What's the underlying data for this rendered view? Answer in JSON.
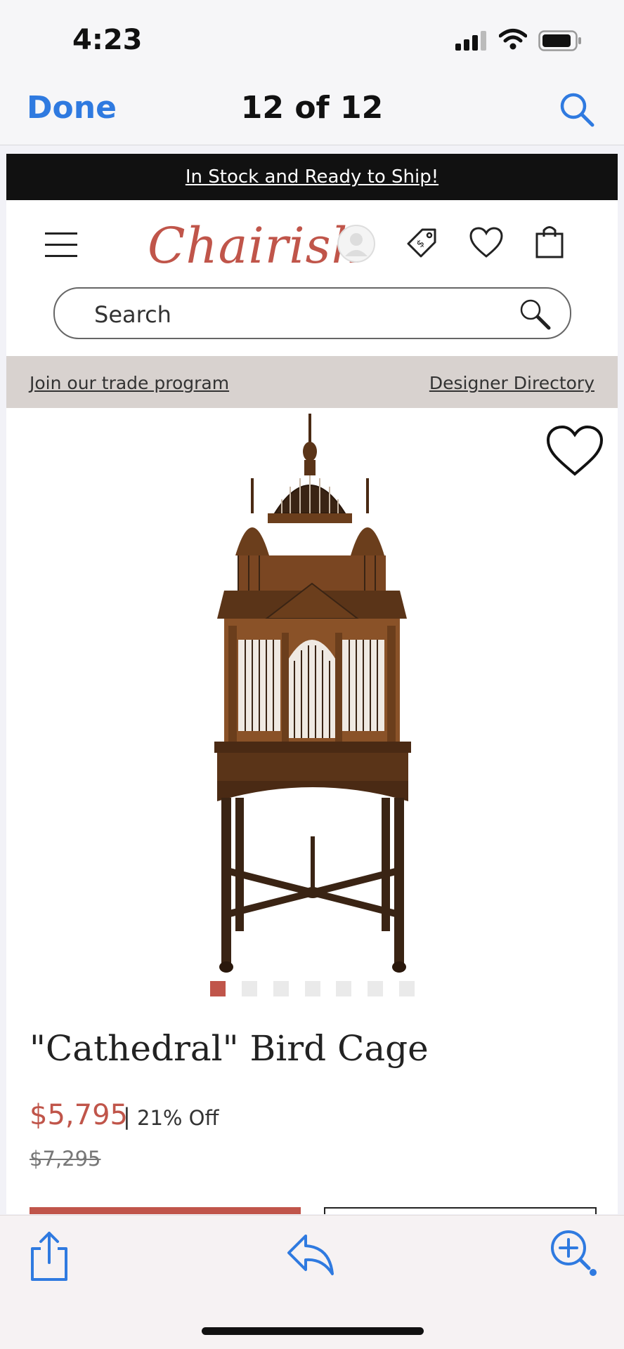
{
  "status_bar": {
    "time": "4:23",
    "icons": [
      "signal-icon",
      "wifi-icon",
      "battery-icon"
    ]
  },
  "nav": {
    "done_label": "Done",
    "title": "12 of 12",
    "search_icon": "search-icon"
  },
  "page": {
    "banner_text": "In Stock and Ready to Ship!",
    "logo_text": "Chairish",
    "header_icons": [
      "menu-icon",
      "account-icon",
      "price-tag-icon",
      "heart-icon",
      "shopping-bag-icon"
    ],
    "search": {
      "placeholder": "Search"
    },
    "links": {
      "trade": "Join our trade program",
      "directory": "Designer Directory"
    },
    "product": {
      "title": "\"Cathedral\" Bird Cage",
      "price": "$5,795",
      "separator": "|",
      "discount": "21% Off",
      "original_price": "$7,295",
      "image_count": 7,
      "active_image": 1
    }
  },
  "toolbar": {
    "icons": [
      "share-icon",
      "reply-icon",
      "zoom-in-icon"
    ]
  },
  "colors": {
    "accent": "#2f7ae0",
    "brand": "#c0554a",
    "banner_bg": "#111111",
    "trade_bar_bg": "#d8d2cf"
  }
}
